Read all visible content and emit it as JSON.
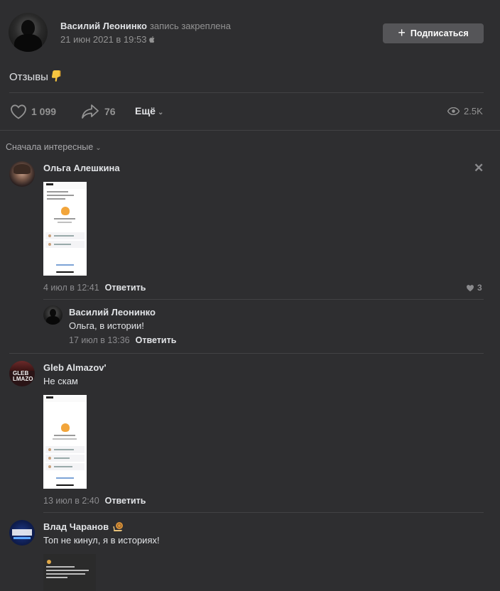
{
  "post": {
    "author": "Василий Леонинко",
    "pinned_label": "запись закреплена",
    "date": "21 июн 2021 в 19:53",
    "subscribe_label": "Подписаться",
    "text": "Отзывы",
    "likes": "1 099",
    "shares": "76",
    "more_label": "Ещё",
    "views": "2.5K"
  },
  "sort_label": "Сначала интересные",
  "comments": [
    {
      "author": "Ольга Алешкина",
      "time": "4 июл в 12:41",
      "reply_label": "Ответить",
      "likes": "3",
      "reply": {
        "author": "Василий Леонинко",
        "text": "Ольга, в истории!",
        "time": "17 июл в 13:36",
        "reply_label": "Ответить"
      }
    },
    {
      "author": "Gleb Almazov'",
      "text": "Не скам",
      "time": "13 июл в 2:40",
      "reply_label": "Ответить"
    },
    {
      "author": "Влад Чаранов",
      "text": "Топ не кинул, я в историях!"
    }
  ],
  "colors": {
    "background": "#2e2e30",
    "button": "#555558",
    "divider": "#424244",
    "muted": "#939393"
  }
}
